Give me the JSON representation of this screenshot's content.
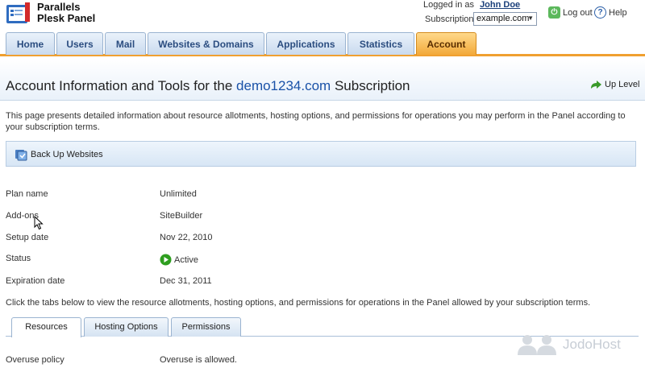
{
  "brand": {
    "line1": "Parallels",
    "line2": "Plesk Panel"
  },
  "header": {
    "logged_in_label": "Logged in as",
    "user_name": "John Doe",
    "subscription_label": "Subscription",
    "subscription_value": "example.com",
    "logout_label": "Log out",
    "help_label": "Help"
  },
  "tabs": [
    {
      "label": "Home"
    },
    {
      "label": "Users"
    },
    {
      "label": "Mail"
    },
    {
      "label": "Websites & Domains"
    },
    {
      "label": "Applications"
    },
    {
      "label": "Statistics"
    },
    {
      "label": "Account",
      "active": true
    }
  ],
  "page": {
    "title_prefix": "Account Information and Tools for the",
    "title_domain": "demo1234.com",
    "title_suffix": "Subscription",
    "up_level": "Up Level",
    "description": "This page presents detailed information about resource allotments, hosting options, and permissions for operations you may perform in the Panel according to your subscription terms."
  },
  "toolbar": {
    "backup_label": "Back Up Websites"
  },
  "info": [
    {
      "label": "Plan name",
      "value": "Unlimited"
    },
    {
      "label": "Add-ons",
      "value": "SiteBuilder"
    },
    {
      "label": "Setup date",
      "value": "Nov 22, 2010"
    },
    {
      "label": "Status",
      "value": "Active"
    },
    {
      "label": "Expiration date",
      "value": "Dec 31, 2011"
    }
  ],
  "hint": "Click the tabs below to view the resource allotments, hosting options, and permissions for operations in the Panel allowed by your subscription terms.",
  "subtabs": [
    {
      "label": "Resources",
      "active": true
    },
    {
      "label": "Hosting Options"
    },
    {
      "label": "Permissions"
    }
  ],
  "overuse": {
    "label": "Overuse policy",
    "value": "Overuse is allowed."
  },
  "watermark": "JodoHost",
  "colors": {
    "accent_tab": "#f2a93a",
    "link": "#1a52a8",
    "status_green": "#2e9e1f"
  }
}
